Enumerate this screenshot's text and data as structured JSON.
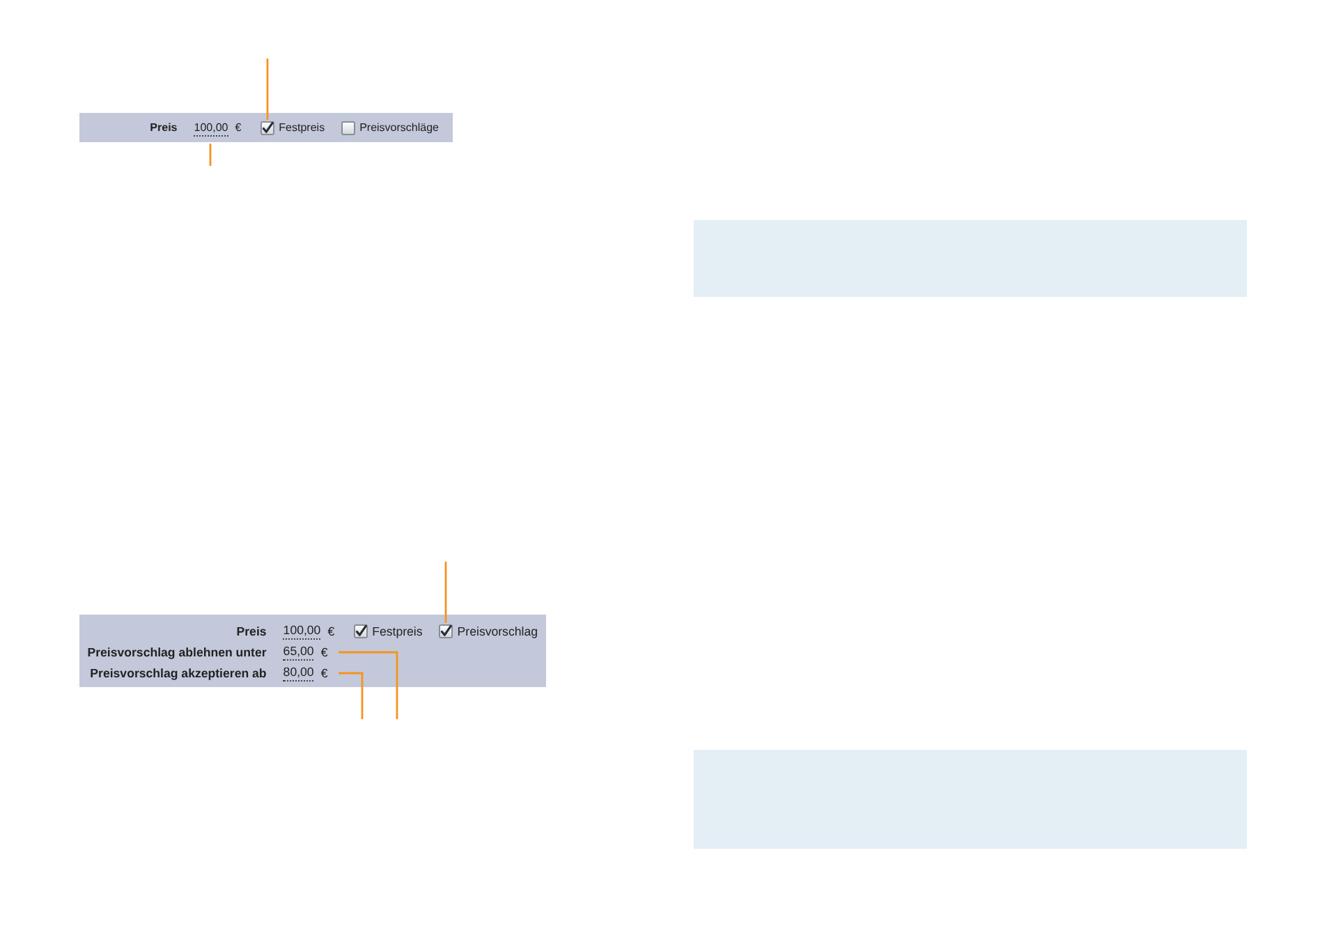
{
  "figures": [
    {
      "price": {
        "label": "Preis",
        "value": "100,00",
        "currency": "€",
        "callout": true
      },
      "options": [
        {
          "label": "Festpreis",
          "checked": true,
          "callout": true
        },
        {
          "label": "Preisvorschläge",
          "checked": false,
          "callout": false
        }
      ]
    },
    {
      "price": {
        "label": "Preis",
        "value": "100,00",
        "currency": "€",
        "callout": false
      },
      "options": [
        {
          "label": "Festpreis",
          "checked": true,
          "callout": false
        },
        {
          "label": "Preisvorschlag",
          "checked": true,
          "callout": true
        }
      ],
      "thresholds": [
        {
          "label": "Preisvorschlag ablehnen unter",
          "value": "65,00",
          "currency": "€",
          "callout": true
        },
        {
          "label": "Preisvorschlag akzeptieren ab",
          "value": "80,00",
          "currency": "€",
          "callout": true
        }
      ]
    }
  ]
}
